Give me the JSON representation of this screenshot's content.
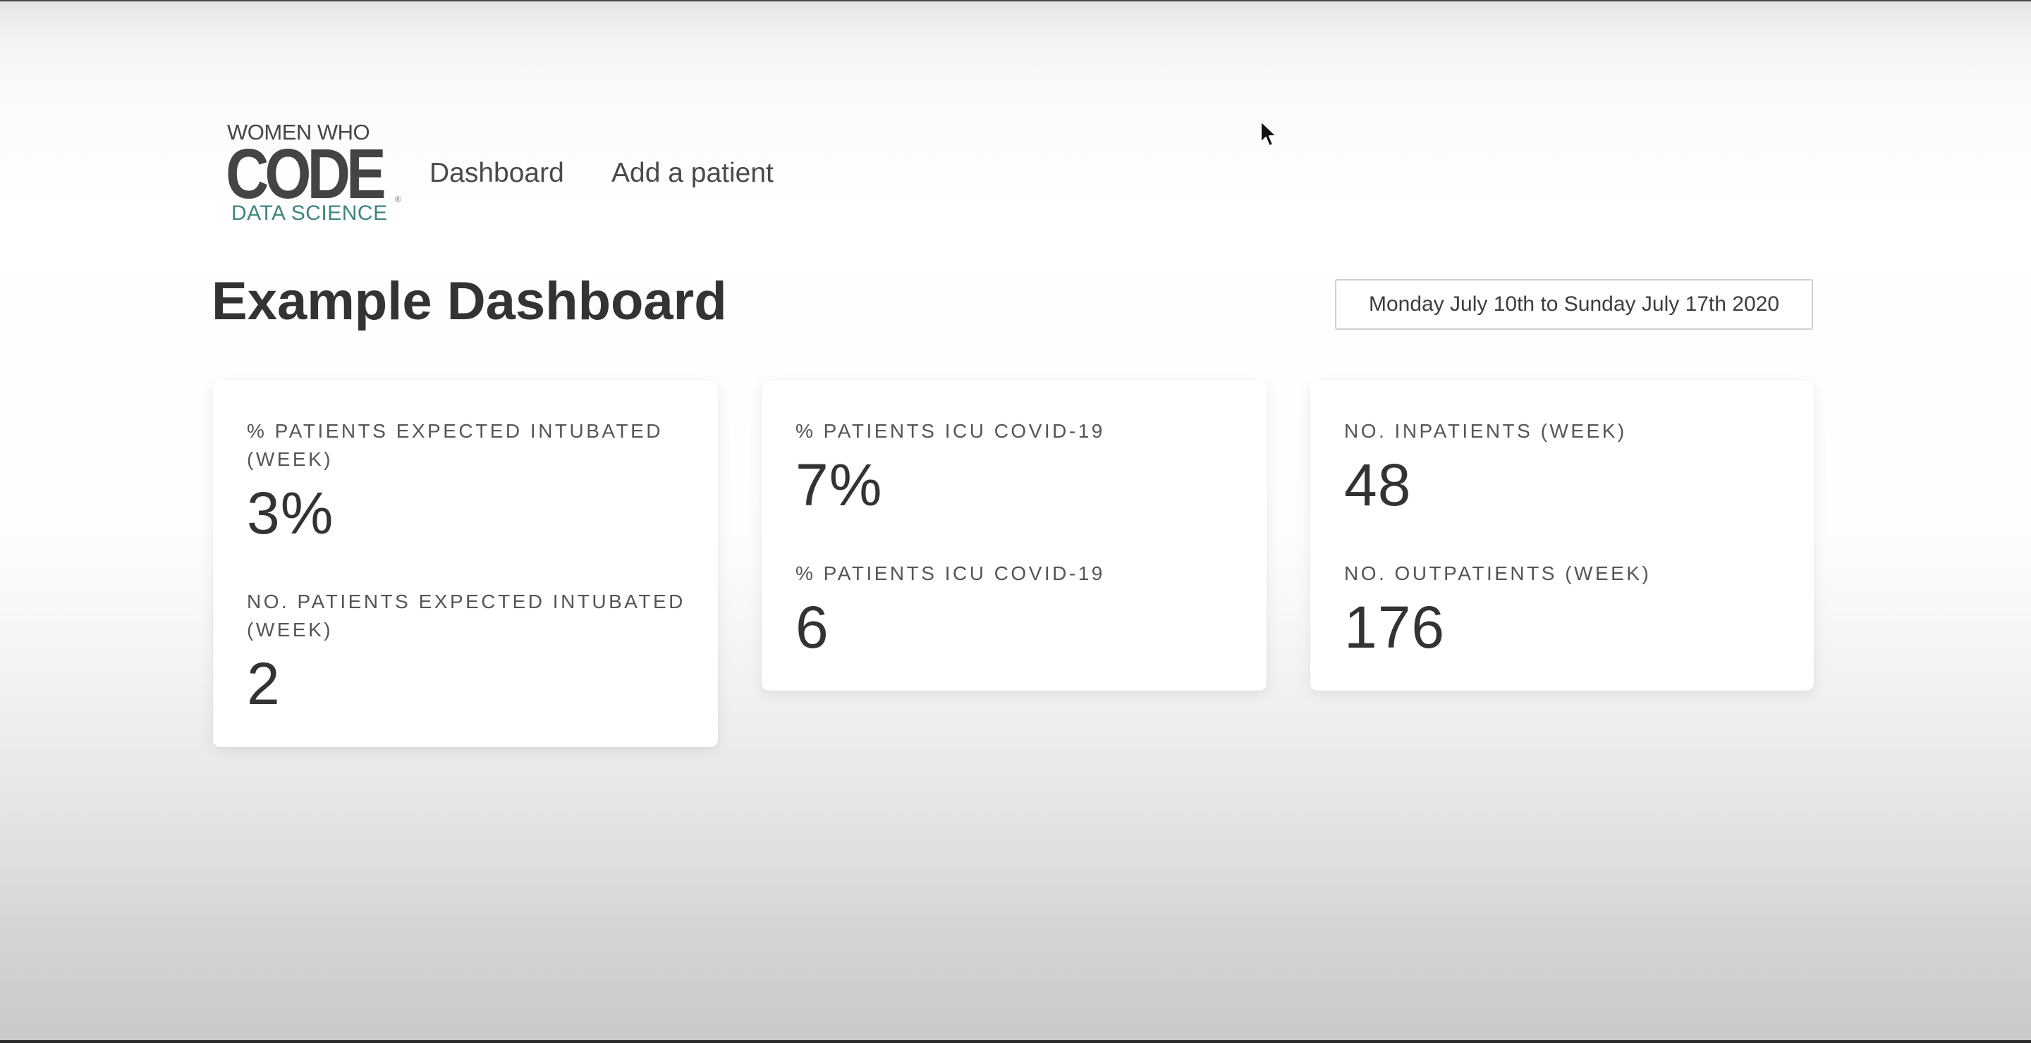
{
  "logo": {
    "line1": "WOMEN WHO",
    "line2": "CODE",
    "line3": "DATA SCIENCE",
    "registered": "®",
    "colors": {
      "primary": "#444444",
      "accent": "#3e8580"
    }
  },
  "nav": {
    "items": [
      {
        "label": "Dashboard"
      },
      {
        "label": "Add a patient"
      }
    ]
  },
  "page": {
    "title": "Example Dashboard",
    "date_range": "Monday July 10th to Sunday July 17th 2020"
  },
  "cards": [
    {
      "metrics": [
        {
          "label": "% PATIENTS EXPECTED INTUBATED (WEEK)",
          "value": "3%"
        },
        {
          "label": "NO. PATIENTS EXPECTED INTUBATED (WEEK)",
          "value": "2"
        }
      ]
    },
    {
      "metrics": [
        {
          "label": "% PATIENTS ICU COVID-19",
          "value": "7%"
        },
        {
          "label": "% PATIENTS ICU COVID-19",
          "value": "6"
        }
      ]
    },
    {
      "metrics": [
        {
          "label": "NO. INPATIENTS (WEEK)",
          "value": "48"
        },
        {
          "label": "NO. OUTPATIENTS (WEEK)",
          "value": "176"
        }
      ]
    }
  ],
  "icons": {
    "cursor": "mouse-pointer-icon"
  }
}
